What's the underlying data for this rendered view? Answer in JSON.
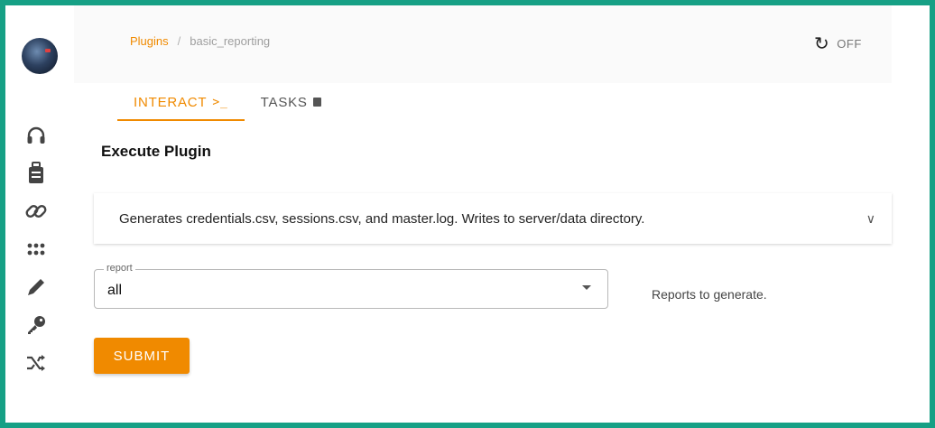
{
  "header": {
    "breadcrumb": {
      "root": "Plugins",
      "separator": "/",
      "current": "basic_reporting"
    },
    "toggle": {
      "icon": "refresh-icon",
      "state": "OFF"
    }
  },
  "tabs": [
    {
      "label": "INTERACT",
      "icon": "terminal-icon",
      "active": true
    },
    {
      "label": "TASKS",
      "icon": "task-icon",
      "active": false
    }
  ],
  "sidebar": {
    "items": [
      {
        "icon": "headset-icon"
      },
      {
        "icon": "luggage-icon"
      },
      {
        "icon": "link-icon"
      },
      {
        "icon": "apps-grid-icon"
      },
      {
        "icon": "pencil-icon"
      },
      {
        "icon": "key-icon"
      },
      {
        "icon": "shuffle-icon"
      }
    ]
  },
  "main": {
    "title": "Execute Plugin",
    "description": "Generates credentials.csv, sessions.csv, and master.log. Writes to server/data directory.",
    "report_field": {
      "label": "report",
      "value": "all",
      "helper": "Reports to generate."
    },
    "submit_label": "SUBMIT"
  },
  "colors": {
    "accent": "#f08a00",
    "frame": "#16a085"
  }
}
